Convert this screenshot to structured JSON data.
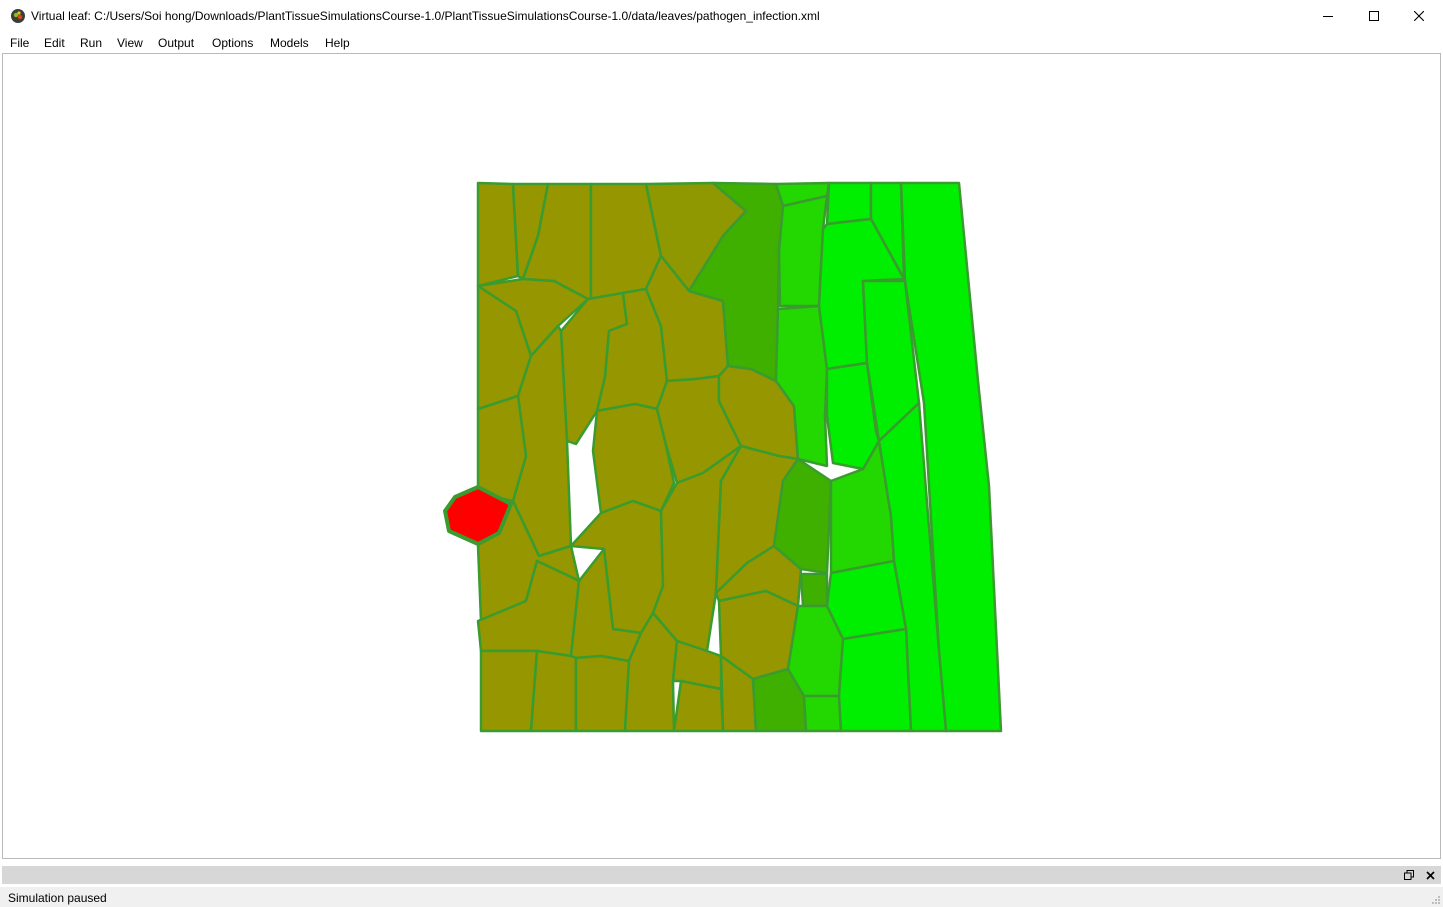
{
  "window": {
    "title": "Virtual leaf: C:/Users/Soi hong/Downloads/PlantTissueSimulationsCourse-1.0/PlantTissueSimulationsCourse-1.0/data/leaves/pathogen_infection.xml",
    "icons": [
      "app-icon",
      "minimize-icon",
      "maximize-icon",
      "close-icon"
    ]
  },
  "menu": [
    "File",
    "Edit",
    "Run",
    "View",
    "Output",
    "Options",
    "Models",
    "Help"
  ],
  "tissue": {
    "colors": {
      "infected": "#ff0000",
      "olive": "#969600",
      "olive_dark": "#8f9800",
      "mid_green": "#3fb000",
      "green": "#22d800",
      "bright_green": "#00ee00",
      "wall": "#3a9b2e"
    }
  },
  "dock": {
    "icons": [
      "float-icon",
      "close-icon"
    ]
  },
  "status": {
    "text": "Simulation paused"
  }
}
